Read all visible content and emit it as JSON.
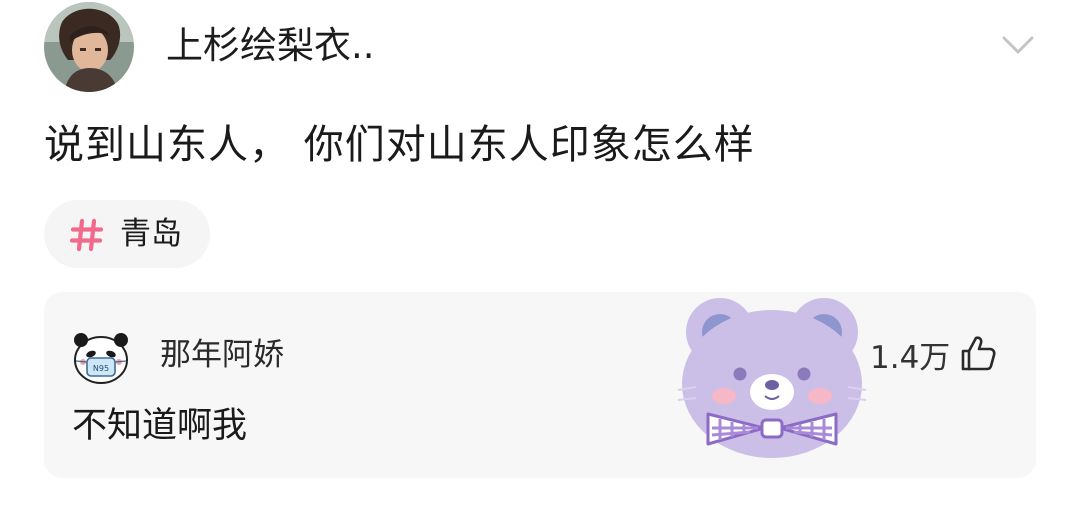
{
  "header": {
    "username": "上杉绘梨衣..",
    "avatar_icon": "user-avatar-icon",
    "more_icon": "chevron-down-icon"
  },
  "post": {
    "text": "说到山东人， 你们对山东人印象怎么样"
  },
  "tag": {
    "icon": "hashtag-icon",
    "label": "青岛",
    "icon_color": "#f06a8c"
  },
  "comment": {
    "avatar_icon": "panda-mask-avatar-icon",
    "mask_label": "N95",
    "username": "那年阿娇",
    "text": "不知道啊我",
    "sticker_icon": "purple-bear-sticker-icon",
    "like_count": "1.4万",
    "like_icon": "thumb-up-icon"
  },
  "colors": {
    "card_background": "#f7f7f7",
    "tag_background": "#f5f5f5",
    "bear_purple": "#cbbfe7"
  }
}
